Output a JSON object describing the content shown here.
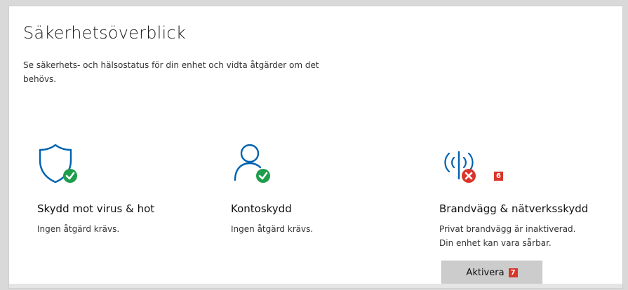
{
  "header": {
    "title": "Säkerhetsöverblick",
    "description": "Se säkerhets- och hälsostatus för din enhet och vidta åtgärder om det behövs."
  },
  "tiles": [
    {
      "icon": "shield-check-icon",
      "title": "Skydd mot virus & hot",
      "status": "Ingen åtgärd krävs."
    },
    {
      "icon": "account-check-icon",
      "title": "Kontoskydd",
      "status": "Ingen åtgärd krävs."
    },
    {
      "icon": "firewall-network-error-icon",
      "badge": "6",
      "title": "Brandvägg & nätverksskydd",
      "status_line1": "Privat brandvägg är inaktiverad.",
      "status_line2": "Din enhet kan vara sårbar.",
      "action": {
        "label": "Aktivera",
        "badge": "7"
      }
    }
  ],
  "colors": {
    "accent": "#0063b1",
    "ok": "#1e9e4a",
    "error": "#d9352a"
  }
}
